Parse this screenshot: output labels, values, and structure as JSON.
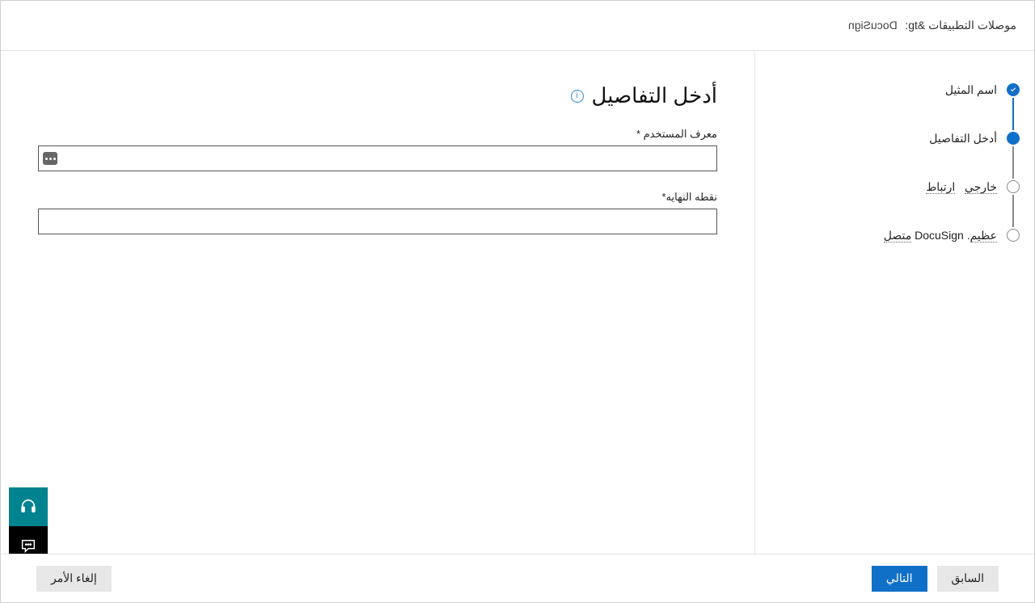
{
  "header": {
    "section": "موصلات التطبيقات &gt:",
    "app_name": "DocuSign"
  },
  "steps": [
    {
      "label": "اسم المثيل",
      "state": "done"
    },
    {
      "label": "أدخل التفاصيل",
      "state": "current"
    },
    {
      "label_html": "<span class='dotted'>خارجي</span>&nbsp;&nbsp;&nbsp;<span class='dotted'>ارتباط</span>",
      "state": "pending"
    },
    {
      "label_html": "<span class='dotted'>عظيم</span>. DocuSign <span class='dotted'>متصل</span>",
      "state": "pending"
    }
  ],
  "page_title": "أدخل التفاصيل",
  "form": {
    "user_id_label": "معرف المستخدم *",
    "endpoint_label": "نقطه النهايه*"
  },
  "footer": {
    "previous": "السابق",
    "next": "التالي",
    "cancel": "إلغاء الأمر"
  }
}
